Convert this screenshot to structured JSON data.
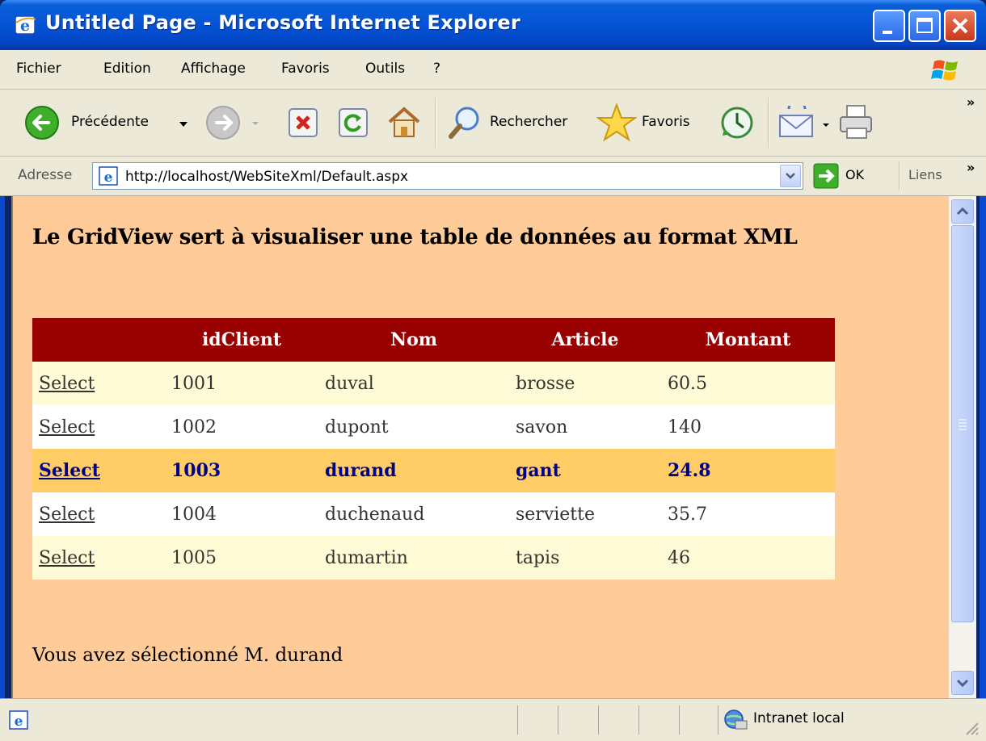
{
  "window": {
    "title": "Untitled Page - Microsoft Internet Explorer"
  },
  "menu": {
    "items": [
      "Fichier",
      "Edition",
      "Affichage",
      "Favoris",
      "Outils",
      "?"
    ]
  },
  "toolbar": {
    "back_label": "Précédente",
    "search_label": "Rechercher",
    "favorites_label": "Favoris"
  },
  "address": {
    "label": "Adresse",
    "url": "http://localhost/WebSiteXml/Default.aspx",
    "go_label": "OK",
    "links_label": "Liens"
  },
  "page": {
    "heading": "Le GridView sert à visualiser une table de données au format XML",
    "grid": {
      "columns": [
        "",
        "idClient",
        "Nom",
        "Article",
        "Montant"
      ],
      "rows": [
        {
          "select": "Select",
          "idClient": "1001",
          "nom": "duval",
          "article": "brosse",
          "montant": "60.5",
          "selected": false
        },
        {
          "select": "Select",
          "idClient": "1002",
          "nom": "dupont",
          "article": "savon",
          "montant": "140",
          "selected": false
        },
        {
          "select": "Select",
          "idClient": "1003",
          "nom": "durand",
          "article": "gant",
          "montant": "24.8",
          "selected": true
        },
        {
          "select": "Select",
          "idClient": "1004",
          "nom": "duchenaud",
          "article": "serviette",
          "montant": "35.7",
          "selected": false
        },
        {
          "select": "Select",
          "idClient": "1005",
          "nom": "dumartin",
          "article": "tapis",
          "montant": "46",
          "selected": false
        }
      ]
    },
    "selected_message": "Vous avez sélectionné M. durand"
  },
  "status": {
    "zone": "Intranet local"
  },
  "colors": {
    "page_background": "#ffcc99",
    "header_row": "#990000",
    "selected_row": "#ffcc66",
    "alt_row": "#fffbd6"
  }
}
